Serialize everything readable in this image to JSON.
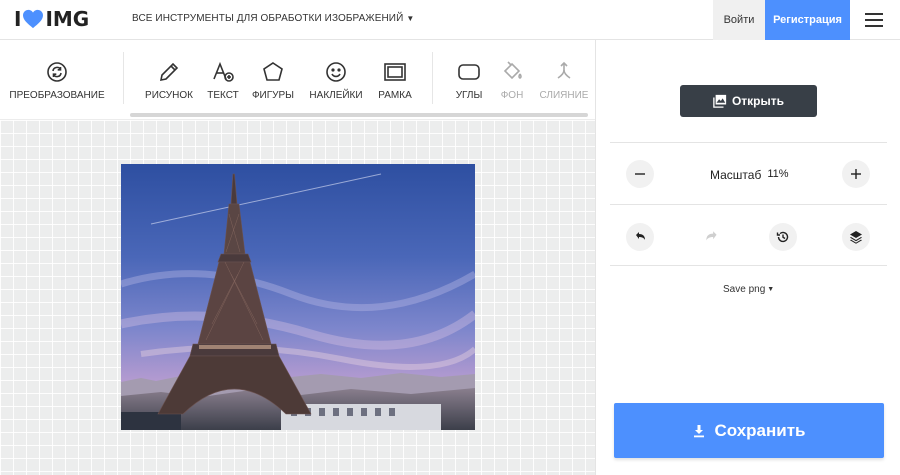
{
  "header": {
    "logo_left": "I",
    "logo_right": "IMG",
    "tools_menu_label": "ВСЕ ИНСТРУМЕНТЫ ДЛЯ ОБРАБОТКИ ИЗОБРАЖЕНИЙ",
    "login_label": "Войти",
    "register_label": "Регистрация",
    "accent_color": "#4d90fe"
  },
  "toolbar": {
    "transform_label": "ПРЕОБРАЗОВАНИЕ",
    "draw_label": "РИСУНОК",
    "text_label": "ТЕКСТ",
    "shapes_label": "ФИГУРЫ",
    "stickers_label": "НАКЛЕЙКИ",
    "frame_label": "РАМКА",
    "corners_label": "УГЛЫ",
    "background_label": "ФОН",
    "merge_label": "СЛИЯНИЕ"
  },
  "panel": {
    "open_label": "Открыть",
    "zoom_label": "Масштаб",
    "zoom_value": "11%",
    "save_format_label": "Save png",
    "save_label": "Сохранить",
    "open_button_color": "#383f47"
  },
  "icons": [
    "heart-icon",
    "chevron-down-icon",
    "hamburger-icon",
    "rotate-icon",
    "pencil-icon",
    "text-icon",
    "shape-icon",
    "smiley-icon",
    "frame-icon",
    "rounded-corners-icon",
    "fill-bucket-icon",
    "merge-icon",
    "image-icon",
    "minus-icon",
    "plus-icon",
    "undo-icon",
    "redo-icon",
    "history-icon",
    "layers-icon",
    "download-icon"
  ]
}
